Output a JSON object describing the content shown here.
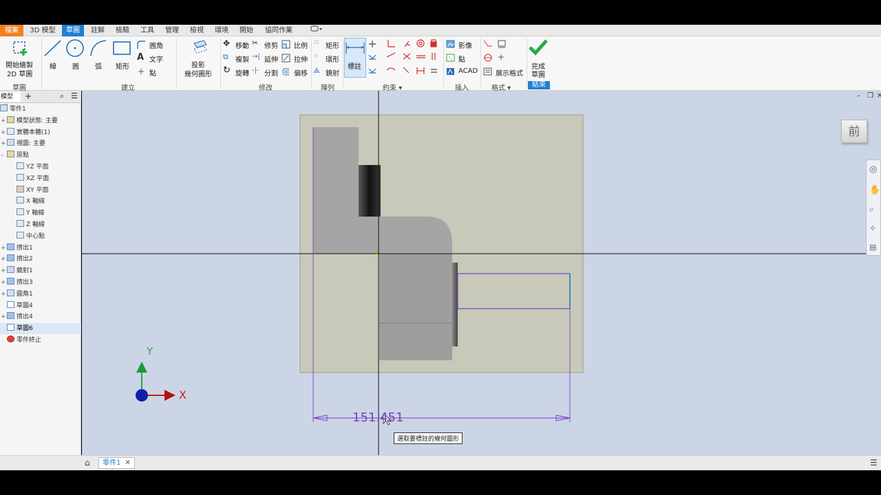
{
  "tabs": [
    "檔案",
    "3D 模型",
    "草圖",
    "註解",
    "檢驗",
    "工具",
    "管理",
    "檢視",
    "環境",
    "開始",
    "協同作業"
  ],
  "ribbon": {
    "start_sketch": [
      "開始繪製",
      "2D 草圖"
    ],
    "sketch_panel": "草圖",
    "line": "線",
    "circle": "圓",
    "arc": "弧",
    "rectangle": "矩形",
    "fillet": "圓角",
    "text": "文字",
    "point": "點",
    "create_panel": "建立",
    "project": [
      "投影",
      "幾何圖形"
    ],
    "move": "移動",
    "copy": "複製",
    "rotate": "旋轉",
    "trim": "修剪",
    "extend": "延伸",
    "split": "分割",
    "scale": "比例",
    "stretch": "拉伸",
    "offset": "偏移",
    "modify_panel": "修改",
    "rect_pattern": "矩形",
    "circ_pattern": "環形",
    "mirror": "鏡射",
    "pattern_panel": "陣列",
    "dimension": "標註",
    "constrain_panel": "約束",
    "image": "影像",
    "points": "點",
    "acad": "ACAD",
    "insert_panel": "插入",
    "show_format": "展示格式",
    "format_panel": "格式",
    "finish_sketch": [
      "完成",
      "草圖"
    ],
    "exit_panel": "結束"
  },
  "browser": {
    "tab": "模型",
    "items": [
      "零件1",
      "模型狀態: 主要",
      "實體本體(1)",
      "視圖: 主要",
      "原點",
      "YZ 平面",
      "XZ 平面",
      "XY 平面",
      "X 軸線",
      "Y 軸線",
      "Z 軸線",
      "中心點",
      "擠出1",
      "擠出2",
      "鏡射1",
      "擠出3",
      "圓角1",
      "草圖4",
      "擠出4",
      "草圖6",
      "零件終止"
    ]
  },
  "viewcube": "前",
  "axes": {
    "y": "Y",
    "x": "X"
  },
  "dimension_value": "151.451",
  "tooltip": "選取要標註的幾何圖形",
  "doc_tab": "零件1",
  "colors": {
    "file_tab": "#f0811f",
    "active_tab": "#1f7fd0",
    "sketch_line": "#7b3fc4",
    "finish_check": "#2aa84a"
  }
}
